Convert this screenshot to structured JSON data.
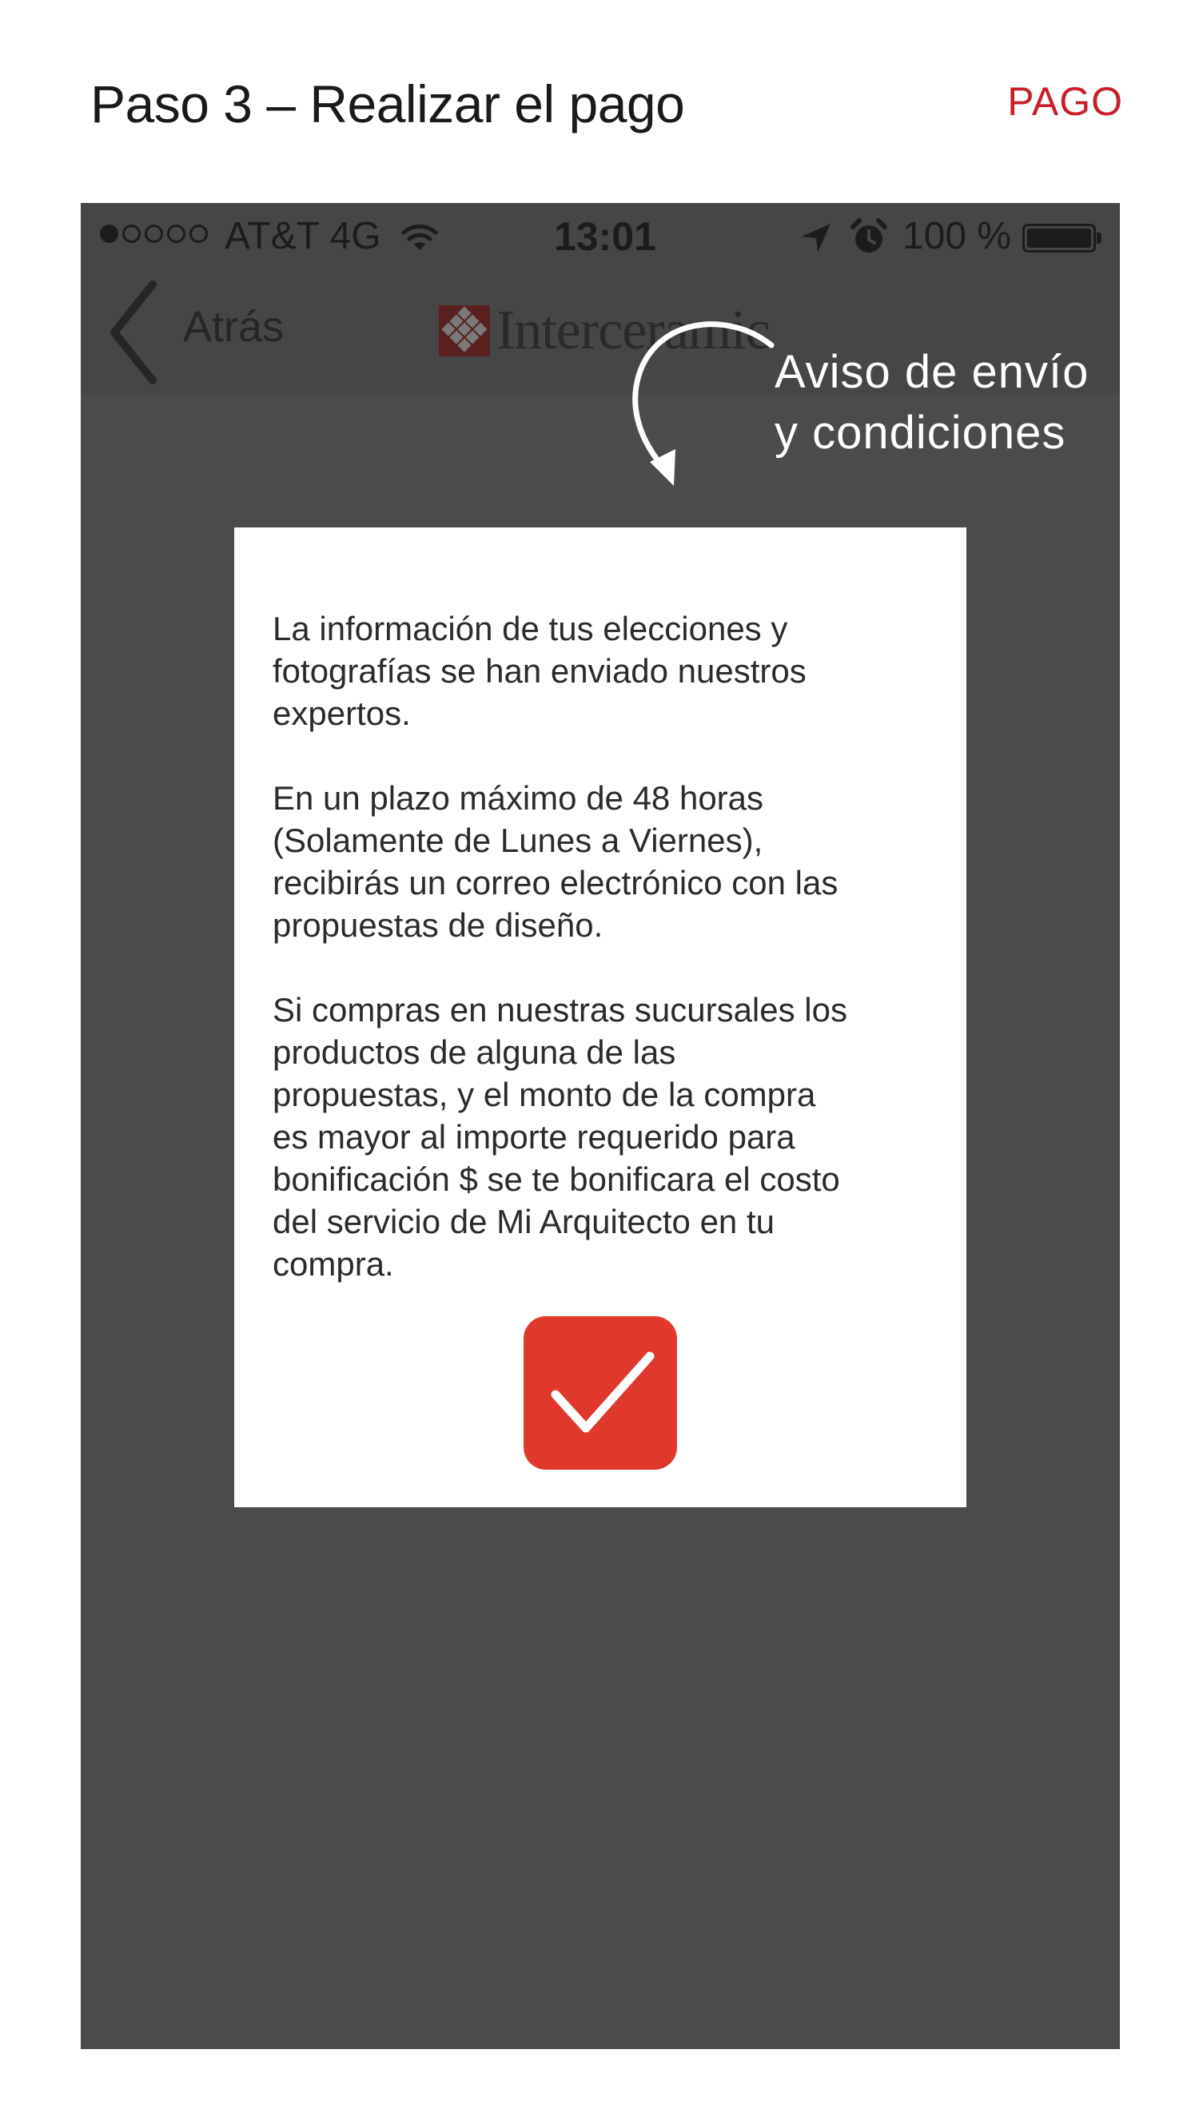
{
  "page": {
    "heading": "Paso 3 – Realizar el pago",
    "section": "PAGO"
  },
  "statusbar": {
    "carrier": "AT&T 4G",
    "time": "13:01",
    "battery": "100 %",
    "signal_bars_filled": 1,
    "signal_bars_total": 5
  },
  "navbar": {
    "back_label": "Atrás",
    "brand": "Interceramic"
  },
  "annotation": {
    "line1": "Aviso de envío",
    "line2": "y condiciones"
  },
  "modal": {
    "paragraph1": "La información de tus elecciones y\nfotografías se han enviado nuestros\nexpertos.",
    "paragraph2": "En un plazo máximo de 48 horas\n(Solamente de Lunes a Viernes),\nrecibirás un correo electrónico con las\npropuestas de diseño.",
    "paragraph3": "Si compras en nuestras sucursales los\nproductos de alguna de las\npropuestas, y el monto de la compra\nes mayor al importe requerido para\nbonificación $ se te bonificara el costo\ndel servicio de Mi Arquitecto en tu\ncompra."
  },
  "colors": {
    "accent": "#c8202a",
    "confirm": "#e0392c",
    "overlay": "#4b4b4b"
  },
  "icons": {
    "back": "chevron-left-icon",
    "confirm": "checkmark-icon",
    "wifi": "wifi-icon",
    "location": "location-arrow-icon",
    "alarm": "alarm-clock-icon",
    "battery": "battery-icon",
    "brand": "interceramic-logo"
  }
}
